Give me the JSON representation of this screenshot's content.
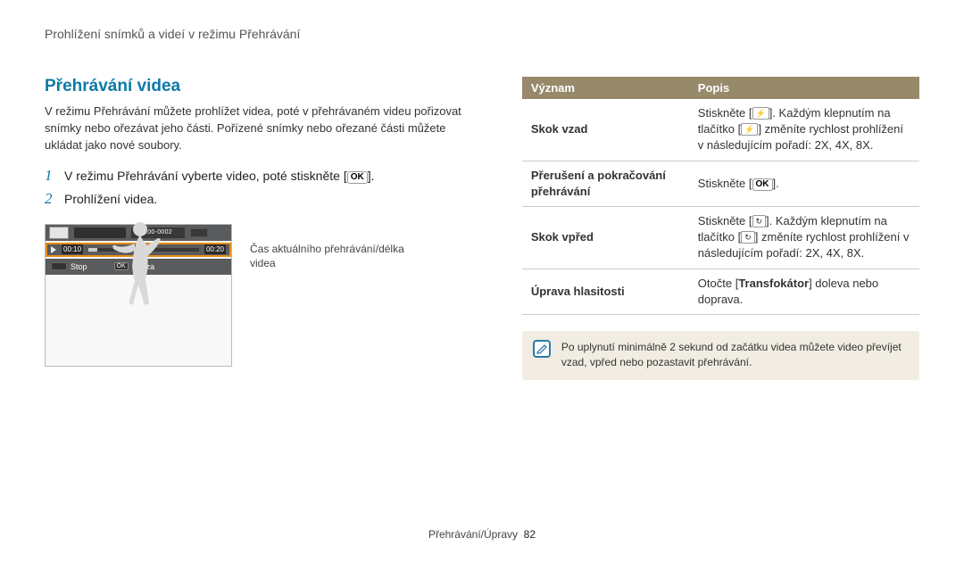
{
  "breadcrumb": "Prohlížení snímků a videí v režimu Přehrávání",
  "section_title": "Přehrávání videa",
  "intro": "V režimu Přehrávání můžete prohlížet videa, poté v přehrávaném videu pořizovat snímky nebo ořezávat jeho části. Pořízené snímky nebo ořezané části můžete ukládat jako nové soubory.",
  "steps": [
    {
      "num": "1",
      "text": "V režimu Přehrávání vyberte video, poté stiskněte [",
      "trailing": "]."
    },
    {
      "num": "2",
      "text": "Prohlížení videa.",
      "trailing": ""
    }
  ],
  "ok_label": "OK",
  "camera": {
    "counter": "100-0002",
    "time_cur": "00:10",
    "time_total": "00:20",
    "stop": "Stop",
    "pause": "Pauza",
    "ok": "OK"
  },
  "annotation": "Čas aktuálního přehrávání/délka videa",
  "table": {
    "headers": [
      "Význam",
      "Popis"
    ],
    "rows": [
      {
        "label": "Skok vzad",
        "desc_pre": "Stiskněte [",
        "icon": "flash",
        "desc_mid": "]. Každým klepnutím na tlačítko [",
        "desc_post": "] změníte rychlost prohlížení v následujícím pořadí: 2X, 4X, 8X."
      },
      {
        "label": "Přerušení a pokračování přehrávání",
        "desc_pre": "Stiskněte [",
        "icon": "ok",
        "desc_mid": "",
        "desc_post": "]."
      },
      {
        "label": "Skok vpřed",
        "desc_pre": "Stiskněte [",
        "icon": "timer",
        "desc_mid": "]. Každým klepnutím na tlačítko [",
        "desc_post": "] změníte rychlost prohlížení v následujícím pořadí: 2X, 4X, 8X."
      },
      {
        "label": "Úprava hlasitosti",
        "desc_pre": "Otočte [",
        "bold": "Transfokátor",
        "desc_post": "] doleva nebo doprava."
      }
    ]
  },
  "note": "Po uplynutí minimálně 2 sekund od začátku videa můžete video převíjet vzad, vpřed nebo pozastavit přehrávání.",
  "footer": {
    "section": "Přehrávání/Úpravy",
    "page": "82"
  }
}
